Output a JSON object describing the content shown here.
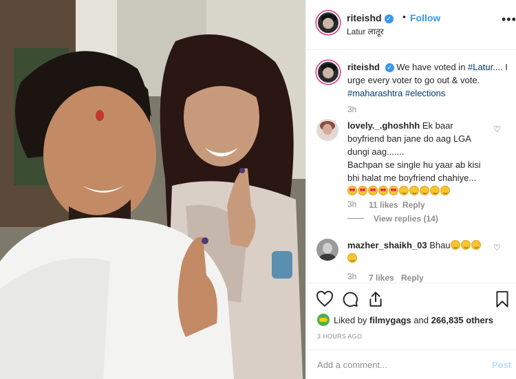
{
  "header": {
    "username": "riteishd",
    "separator": "•",
    "follow_label": "Follow",
    "location": "Latur लातूर",
    "more_icon": "more-horizontal-icon"
  },
  "caption": {
    "username": "riteishd",
    "text": "We have voted in ",
    "tag_location": "#Latur",
    "text2": ".... I urge every voter to go out & vote. ",
    "tag1": "#maharashtra",
    "tag2": "#elections",
    "time": "3h"
  },
  "comments": [
    {
      "username": "lovely._.ghoshhh",
      "text": "Ek baar boyfriend ban jane do aag LGA dungi aag.......",
      "text2": "Bachpan se single hu yaar ab kisi bhi halat me boyfriend chahiye...",
      "time": "3h",
      "likes": "11 likes",
      "reply": "Reply",
      "view_replies": "View replies (14)"
    },
    {
      "username": "mazher_shaikh_03",
      "text": "Bhau",
      "time": "3h",
      "likes": "7 likes",
      "reply": "Reply"
    }
  ],
  "actions": {
    "liked_by_prefix": "Liked by ",
    "liked_by_user": "filmygags",
    "liked_by_and": " and ",
    "liked_by_count": "266,835 others",
    "timestamp": "3 HOURS AGO"
  },
  "add_comment": {
    "placeholder": "Add a comment...",
    "post_label": "Post"
  },
  "colors": {
    "link_blue": "#3897f0",
    "hashtag": "#003569",
    "muted": "#8e8e8e",
    "post_disabled": "#b2dffc"
  }
}
